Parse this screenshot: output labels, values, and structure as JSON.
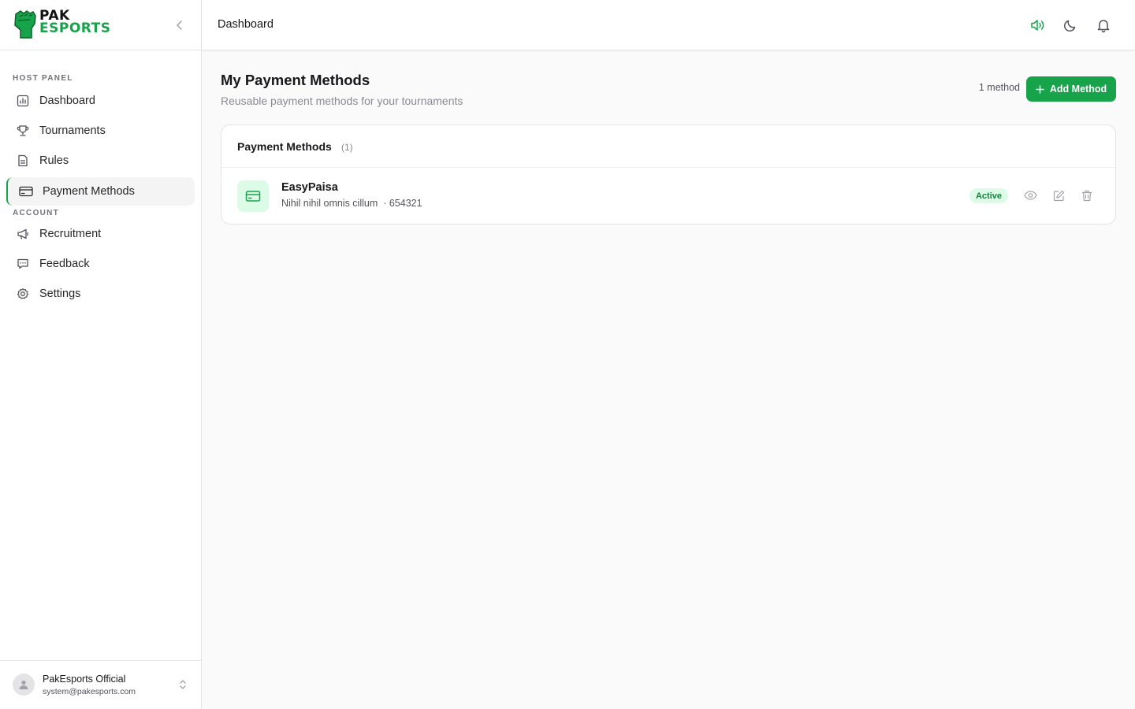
{
  "sidebar": {
    "logo": {
      "line1": "PAK",
      "line2": "ESPORTS"
    },
    "sections": {
      "host": "HOST PANEL",
      "account": "ACCOUNT"
    },
    "items": [
      {
        "label": "Dashboard",
        "icon": "chart-icon"
      },
      {
        "label": "Tournaments",
        "icon": "trophy-icon"
      },
      {
        "label": "Rules",
        "icon": "document-icon"
      },
      {
        "label": "Payment Methods",
        "icon": "credit-card-icon",
        "active": true
      },
      {
        "label": "Recruitment",
        "icon": "megaphone-icon"
      },
      {
        "label": "Feedback",
        "icon": "chat-icon"
      },
      {
        "label": "Settings",
        "icon": "gear-icon"
      }
    ],
    "user": {
      "name": "PakEsports Official",
      "email": "system@pakesports.com"
    }
  },
  "topbar": {
    "title": "Dashboard",
    "icons": [
      "speaker-icon",
      "moon-icon",
      "bell-icon"
    ]
  },
  "main": {
    "title": "My Payment Methods",
    "subtitle": "Reusable payment methods for your tournaments",
    "count_label": "1 method",
    "add_button": "Add Method",
    "card": {
      "title": "Payment Methods",
      "count": "(1)",
      "methods": [
        {
          "name": "EasyPaisa",
          "detail": "Nihil nihil omnis cillum  · 654321",
          "status": "Active"
        }
      ]
    }
  },
  "colors": {
    "accent": "#16a34a",
    "accent_light": "#dcfce7",
    "border": "#e4e4e7",
    "background": "#fafafa"
  }
}
